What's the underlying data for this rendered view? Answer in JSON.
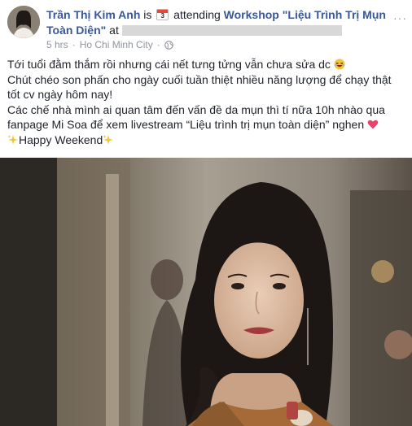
{
  "post": {
    "author_name": "Trần Thị Kim Anh",
    "is_text": "is",
    "activity_text": "attending",
    "event_name": "Workshop \"Liệu Trình Trị Mụn Toàn Diện\"",
    "at_text": "at",
    "time": "5 hrs",
    "separator": "·",
    "location": "Ho Chi Minh City",
    "privacy_icon": "globe-icon",
    "calendar_day": "3",
    "more_label": "···"
  },
  "body": {
    "line1": "Tới tuổi đằm thắm rồi nhưng cái nết tưng tửng vẫn chưa sửa dc ",
    "line2": "Chút chéo son phấn cho ngày cuối tuần thiệt nhiều năng lượng để chạy thật tốt cv ngày hôm nay!",
    "line3": "Các chế nhà mình ai quan tâm đến vấn đề da mụn thì tí nữa 10h nhào qua fanpage Mi Soa để xem livestream “Liệu trình trị mụn toàn diện” nghen ",
    "line4": "Happy Weekend"
  },
  "colors": {
    "link": "#385898",
    "text": "#1d2129",
    "meta": "#90949c"
  }
}
